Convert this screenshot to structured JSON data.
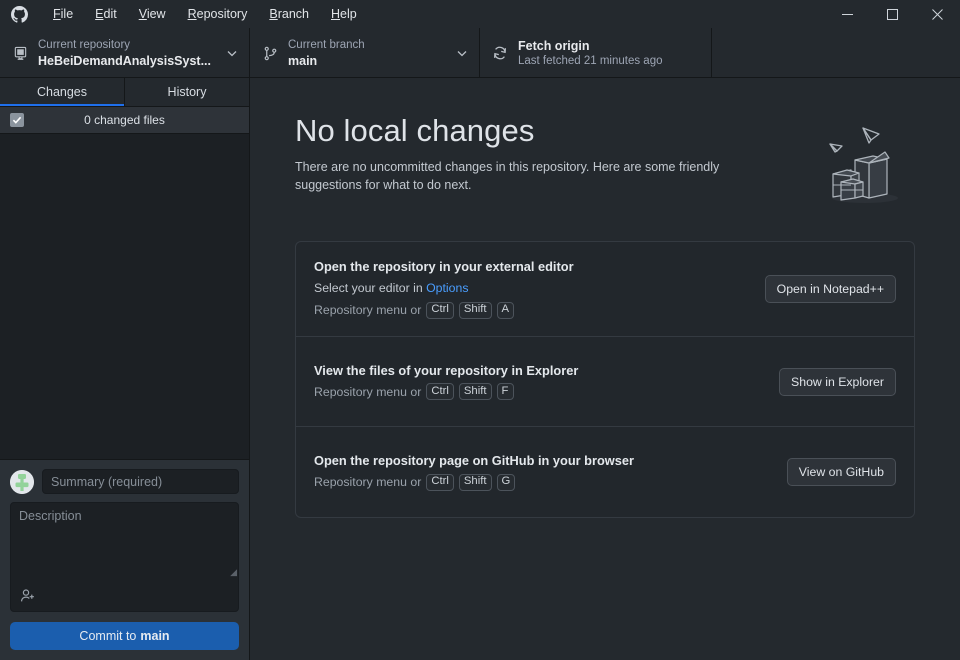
{
  "window": {
    "app_icon": "github-logo-icon",
    "controls": {
      "minimize": "minimize-icon",
      "maximize": "maximize-icon",
      "close": "close-icon"
    }
  },
  "menubar": {
    "items": [
      {
        "label": "File",
        "mnemonic": "F",
        "rest": "ile"
      },
      {
        "label": "Edit",
        "mnemonic": "E",
        "rest": "dit"
      },
      {
        "label": "View",
        "mnemonic": "V",
        "rest": "iew"
      },
      {
        "label": "Repository",
        "mnemonic": "R",
        "rest": "epository"
      },
      {
        "label": "Branch",
        "mnemonic": "B",
        "rest": "ranch"
      },
      {
        "label": "Help",
        "mnemonic": "H",
        "rest": "elp"
      }
    ]
  },
  "toolbar": {
    "repository": {
      "label": "Current repository",
      "value": "HeBeiDemandAnalysisSyst...",
      "icon": "repository-icon",
      "caret": "chevron-down-icon"
    },
    "branch": {
      "label": "Current branch",
      "value": "main",
      "icon": "git-branch-icon",
      "caret": "chevron-down-icon"
    },
    "fetch": {
      "label": "Fetch origin",
      "value": "Last fetched 21 minutes ago",
      "icon": "sync-icon"
    }
  },
  "sidebar": {
    "tabs": [
      {
        "label": "Changes",
        "active": true
      },
      {
        "label": "History",
        "active": false
      }
    ],
    "changed_files": {
      "label": "0 changed files",
      "checkbox_checked": true
    },
    "commit": {
      "avatar": "user-avatar",
      "summary_placeholder": "Summary (required)",
      "summary_value": "",
      "description_placeholder": "Description",
      "description_value": "",
      "coauthor_icon": "add-co-author-icon",
      "button_prefix": "Commit to ",
      "button_branch": "main"
    }
  },
  "main": {
    "title": "No local changes",
    "subtitle": "There are no uncommitted changes in this repository. Here are some friendly suggestions for what to do next.",
    "illustration": "empty-boxes-paper-planes-illustration",
    "cards": [
      {
        "title": "Open the repository in your external editor",
        "desc_prefix": "Select your editor in ",
        "desc_link": "Options",
        "hint_prefix": "Repository menu or",
        "keys": [
          "Ctrl",
          "Shift",
          "A"
        ],
        "button": "Open in Notepad++"
      },
      {
        "title": "View the files of your repository in Explorer",
        "desc_prefix": "",
        "desc_link": "",
        "hint_prefix": "Repository menu or",
        "keys": [
          "Ctrl",
          "Shift",
          "F"
        ],
        "button": "Show in Explorer"
      },
      {
        "title": "Open the repository page on GitHub in your browser",
        "desc_prefix": "",
        "desc_link": "",
        "hint_prefix": "Repository menu or",
        "keys": [
          "Ctrl",
          "Shift",
          "G"
        ],
        "button": "View on GitHub"
      }
    ]
  },
  "colors": {
    "accent_blue": "#1b5eae",
    "link_blue": "#4a9eff",
    "tab_underline": "#1f6feb",
    "background": "#24292e",
    "sidebar_bg": "#1c2024"
  }
}
